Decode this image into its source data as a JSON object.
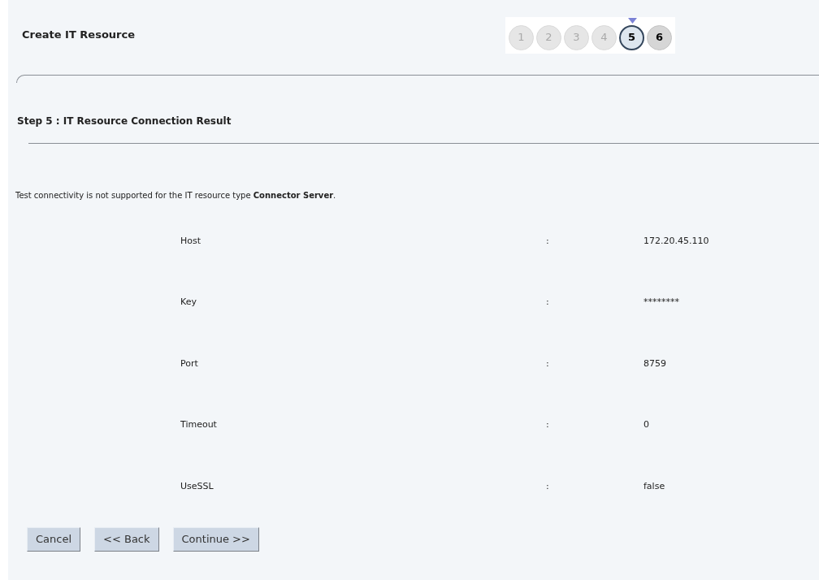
{
  "header": {
    "title": "Create IT Resource"
  },
  "steps": [
    {
      "label": "1",
      "selected": false,
      "disabled": true
    },
    {
      "label": "2",
      "selected": false,
      "disabled": true
    },
    {
      "label": "3",
      "selected": false,
      "disabled": true
    },
    {
      "label": "4",
      "selected": false,
      "disabled": true
    },
    {
      "label": "5",
      "selected": true,
      "disabled": false
    },
    {
      "label": "6",
      "selected": false,
      "disabled": false
    }
  ],
  "section": {
    "title": "Step 5 : IT Resource Connection Result"
  },
  "message": "Test connectivity is not supported for the IT resource type **Connector Server**.",
  "fields": [
    {
      "label": "Host",
      "separator": ":",
      "value": "172.20.45.110"
    },
    {
      "label": "Key",
      "separator": ":",
      "value": "********"
    },
    {
      "label": "Port",
      "separator": ":",
      "value": "8759"
    },
    {
      "label": "Timeout",
      "separator": ":",
      "value": "0"
    },
    {
      "label": "UseSSL",
      "separator": ":",
      "value": "false"
    }
  ],
  "buttons": [
    "Cancel",
    "<< Back",
    "Continue >>"
  ]
}
